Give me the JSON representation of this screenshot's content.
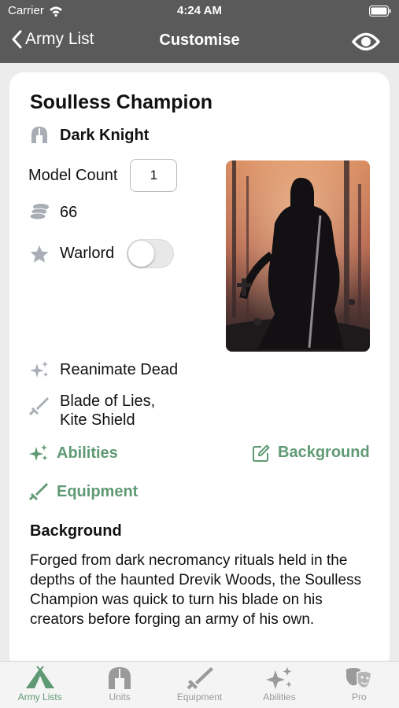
{
  "status_bar": {
    "carrier": "Carrier",
    "time": "4:24 AM"
  },
  "nav": {
    "back_label": "Army List",
    "title": "Customise"
  },
  "unit": {
    "name": "Soulless Champion",
    "class_name": "Dark Knight",
    "model_count_label": "Model Count",
    "model_count": "1",
    "points": "66",
    "warlord_label": "Warlord",
    "warlord_on": false,
    "ability_summary": "Reanimate Dead",
    "equipment_line1": "Blade of Lies,",
    "equipment_line2": "Kite Shield"
  },
  "actions": {
    "abilities": "Abilities",
    "background": "Background",
    "equipment": "Equipment"
  },
  "background": {
    "heading": "Background",
    "text": "Forged from dark necromancy rituals held in the depths of the haunted Drevik Woods, the Soulless Champion was quick to turn his blade on his creators before forging an army of his own."
  },
  "tabs": [
    {
      "label": "Army Lists",
      "icon": "tent-icon",
      "active": true
    },
    {
      "label": "Units",
      "icon": "helmet-icon",
      "active": false
    },
    {
      "label": "Equipment",
      "icon": "sword-icon",
      "active": false
    },
    {
      "label": "Abilities",
      "icon": "sparkles-icon",
      "active": false
    },
    {
      "label": "Pro",
      "icon": "theater-masks-icon",
      "active": false
    }
  ],
  "colors": {
    "accent": "#5f9a74",
    "nav_bg": "#5a5a5a",
    "icon_gray": "#a9adb6",
    "page_bg": "#ececec"
  }
}
